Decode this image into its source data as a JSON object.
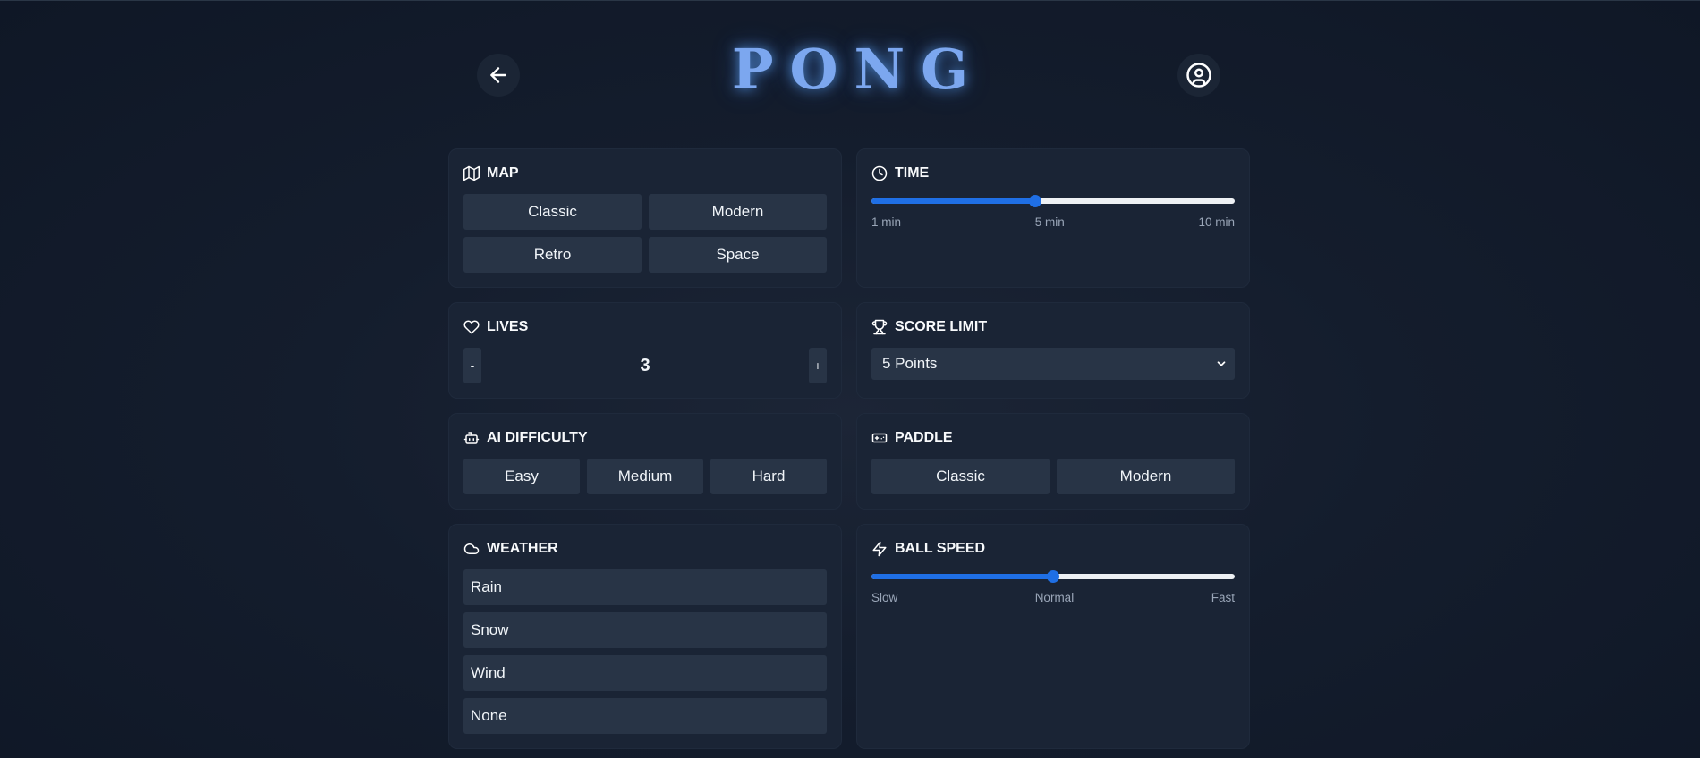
{
  "header": {
    "title": "PONG",
    "back_icon": "arrow-left-icon",
    "profile_icon": "user-circle-icon"
  },
  "map": {
    "label": "MAP",
    "icon": "map-icon",
    "options": [
      "Classic",
      "Modern",
      "Retro",
      "Space"
    ]
  },
  "time": {
    "label": "TIME",
    "icon": "clock-icon",
    "value_fraction": 0.45,
    "labels": [
      "1 min",
      "5 min",
      "10 min"
    ]
  },
  "lives": {
    "label": "LIVES",
    "icon": "heart-icon",
    "decrement": "-",
    "increment": "+",
    "value": "3"
  },
  "score_limit": {
    "label": "SCORE LIMIT",
    "icon": "trophy-icon",
    "selected": "5 Points"
  },
  "ai_difficulty": {
    "label": "AI DIFFICULTY",
    "icon": "bot-icon",
    "options": [
      "Easy",
      "Medium",
      "Hard"
    ]
  },
  "paddle": {
    "label": "PADDLE",
    "icon": "gamepad-icon",
    "options": [
      "Classic",
      "Modern"
    ]
  },
  "weather": {
    "label": "WEATHER",
    "icon": "cloud-icon",
    "options": [
      "Rain",
      "Snow",
      "Wind",
      "None"
    ]
  },
  "ball_speed": {
    "label": "BALL SPEED",
    "icon": "zap-icon",
    "value_fraction": 0.5,
    "labels": [
      "Slow",
      "Normal",
      "Fast"
    ]
  },
  "colors": {
    "accent": "#1f6fe5",
    "card": "#1a2435",
    "button": "#283446",
    "title": "#7ca7ef"
  }
}
